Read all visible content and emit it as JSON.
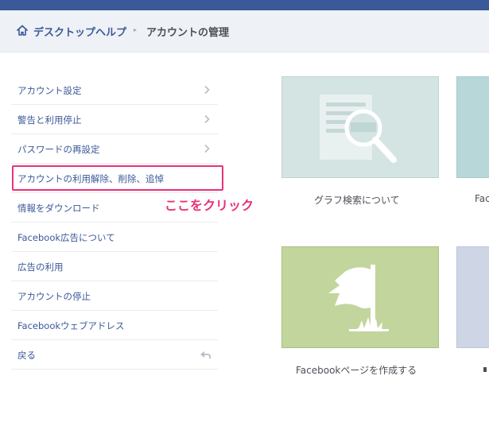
{
  "breadcrumb": {
    "home_icon": "home-icon",
    "link": "デスクトップヘルプ",
    "separator": "▸",
    "current": "アカウントの管理"
  },
  "sidebar": {
    "items": [
      {
        "label": "アカウント設定",
        "icon": "chevron-right-icon"
      },
      {
        "label": "警告と利用停止",
        "icon": "chevron-right-icon"
      },
      {
        "label": "パスワードの再設定",
        "icon": "chevron-right-icon"
      },
      {
        "label": "アカウントの利用解除、削除、追悼",
        "icon": ""
      },
      {
        "label": "情報をダウンロード",
        "icon": ""
      },
      {
        "label": "Facebook広告について",
        "icon": ""
      },
      {
        "label": "広告の利用",
        "icon": ""
      },
      {
        "label": "アカウントの停止",
        "icon": ""
      },
      {
        "label": "Facebookウェブアドレス",
        "icon": ""
      },
      {
        "label": "戻る",
        "icon": "back-arrow-icon"
      }
    ]
  },
  "annotation": {
    "text": "ここをクリック",
    "color": "#e8327a"
  },
  "cards": [
    {
      "caption": "グラフ検索について",
      "icon": "graph-search-icon",
      "color": "#d3e4e3"
    },
    {
      "caption": "Fac",
      "icon": "",
      "color": "#b7d7d8"
    },
    {
      "caption": "Facebookページを作成する",
      "icon": "flag-icon",
      "color": "#c2d59c"
    },
    {
      "caption": "",
      "icon": "",
      "color": "#ced6e6"
    }
  ],
  "colors": {
    "topbar": "#3b5998",
    "link": "#3b5998",
    "highlight": "#e8327a"
  }
}
